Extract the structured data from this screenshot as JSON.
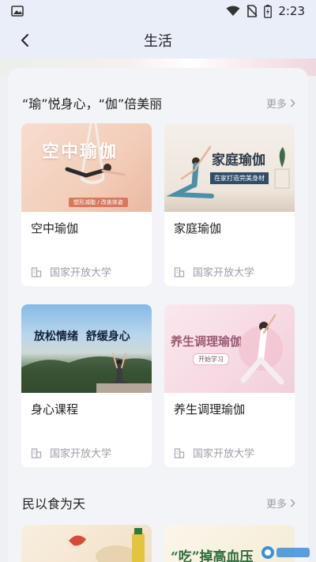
{
  "status_bar": {
    "time": "2:23",
    "icons": [
      "image-icon",
      "wifi-icon",
      "no-sim-icon",
      "battery-charging-icon"
    ]
  },
  "header": {
    "title": "生活",
    "back_icon": "chevron-left-icon"
  },
  "sections": [
    {
      "title": "“瑜”悦身心，“伽”倍美丽",
      "more_label": "更多",
      "cards": [
        {
          "title": "空中瑜伽",
          "school": "国家开放大学",
          "image_text": "空中瑜伽",
          "image_tag": "塑形减脂 / 改善体姿"
        },
        {
          "title": "家庭瑜伽",
          "school": "国家开放大学",
          "image_text": "家庭瑜伽",
          "image_tag": "在家打造完美身材"
        },
        {
          "title": "身心课程",
          "school": "国家开放大学",
          "image_text": "放松情绪  舒缓身心"
        },
        {
          "title": "养生调理瑜伽",
          "school": "国家开放大学",
          "image_text": "养生调理瑜伽",
          "image_tag": "开始学习"
        }
      ]
    },
    {
      "title": "民以食为天",
      "more_label": "更多",
      "cards": [
        {
          "image_text": ""
        },
        {
          "image_text": "“吃”掉高血压"
        }
      ]
    }
  ],
  "colors": {
    "header_bg": "#e9eef9",
    "page_bg": "#f3f4f8",
    "card_bg": "#ffffff",
    "muted_text": "#9a9ea8"
  }
}
